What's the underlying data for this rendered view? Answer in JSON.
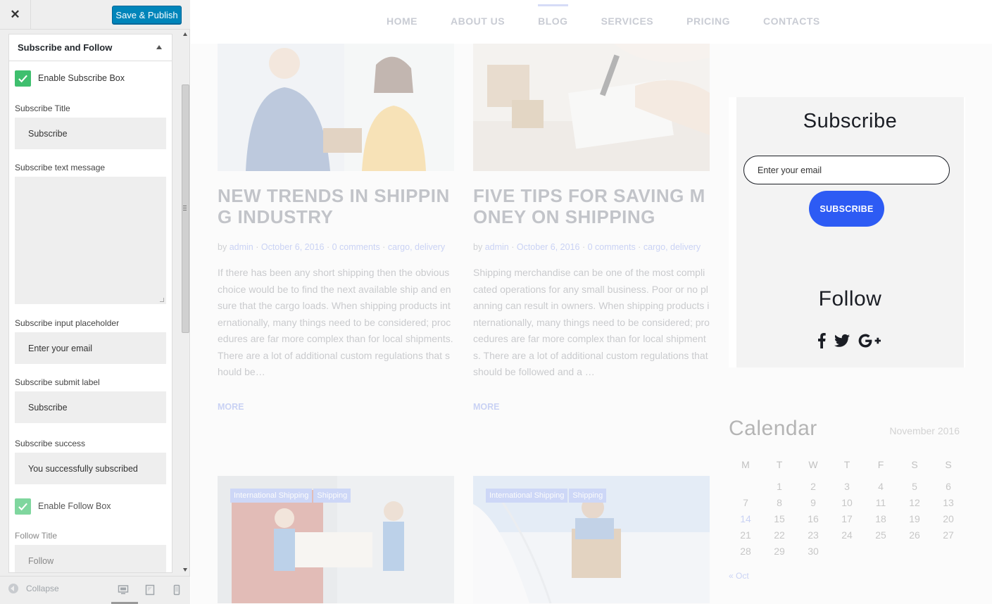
{
  "panel": {
    "close_label": "✕",
    "publish_label": "Save & Publish",
    "section_title": "Subscribe and Follow",
    "enable_subscribe_label": "Enable Subscribe Box",
    "subscribe_title_label": "Subscribe Title",
    "subscribe_title_value": "Subscribe",
    "subscribe_text_label": "Subscribe text message",
    "subscribe_text_value": "",
    "subscribe_placeholder_label": "Subscribe input placeholder",
    "subscribe_placeholder_value": "Enter your email",
    "subscribe_submit_label": "Subscribe submit label",
    "subscribe_submit_value": "Subscribe",
    "subscribe_success_label": "Subscribe success",
    "subscribe_success_value": "You successfully subscribed",
    "enable_follow_label": "Enable Follow Box",
    "follow_title_label": "Follow Title",
    "follow_title_value": "Follow",
    "collapse_label": "Collapse"
  },
  "nav": {
    "items": [
      "HOME",
      "ABOUT US",
      "BLOG",
      "SERVICES",
      "PRICING",
      "CONTACTS"
    ],
    "active": "BLOG"
  },
  "posts": [
    {
      "title": "NEW TRENDS IN SHIPPING INDUSTRY",
      "by": "by",
      "author": "admin",
      "date": "October 6, 2016",
      "comments": "0 comments",
      "categories": "cargo, delivery",
      "excerpt": "If there has been any short shipping then the obvious choice would be to find the next available ship and ensure that the cargo loads. When shipping products internationally, many things need to be considered; procedures are far more complex than for local shipments. There are a lot of additional custom regulations that should be…",
      "more": "MORE"
    },
    {
      "title": "FIVE TIPS FOR SAVING MONEY ON SHIPPING",
      "by": "by",
      "author": "admin",
      "date": "October 6, 2016",
      "comments": "0 comments",
      "categories": "cargo, delivery",
      "excerpt": "Shipping merchandise can be one of the most complicated operations for any small business. Poor or no planning can result in owners. When shipping products internationally, many things need to be considered; procedures are far more complex than for local shipments. There are a lot of additional custom regulations that should be followed and a …",
      "more": "MORE"
    },
    {
      "tags": [
        "International Shipping",
        "Shipping"
      ]
    },
    {
      "tags": [
        "International Shipping",
        "Shipping"
      ]
    }
  ],
  "widget": {
    "subscribe_title": "Subscribe",
    "email_placeholder": "Enter your email",
    "button_label": "SUBSCRIBE",
    "follow_title": "Follow",
    "socials": [
      "facebook-icon",
      "twitter-icon",
      "google-plus-icon"
    ]
  },
  "calendar": {
    "title": "Calendar",
    "month": "November 2016",
    "days": [
      "M",
      "T",
      "W",
      "T",
      "F",
      "S",
      "S"
    ],
    "first_weekday_offset": 1,
    "num_days": 30,
    "highlight": 14,
    "prev_label": "« Oct"
  },
  "colors": {
    "accent": "#2d5bf4",
    "publish": "#0085ba",
    "checkbox": "#3fbf6e"
  }
}
